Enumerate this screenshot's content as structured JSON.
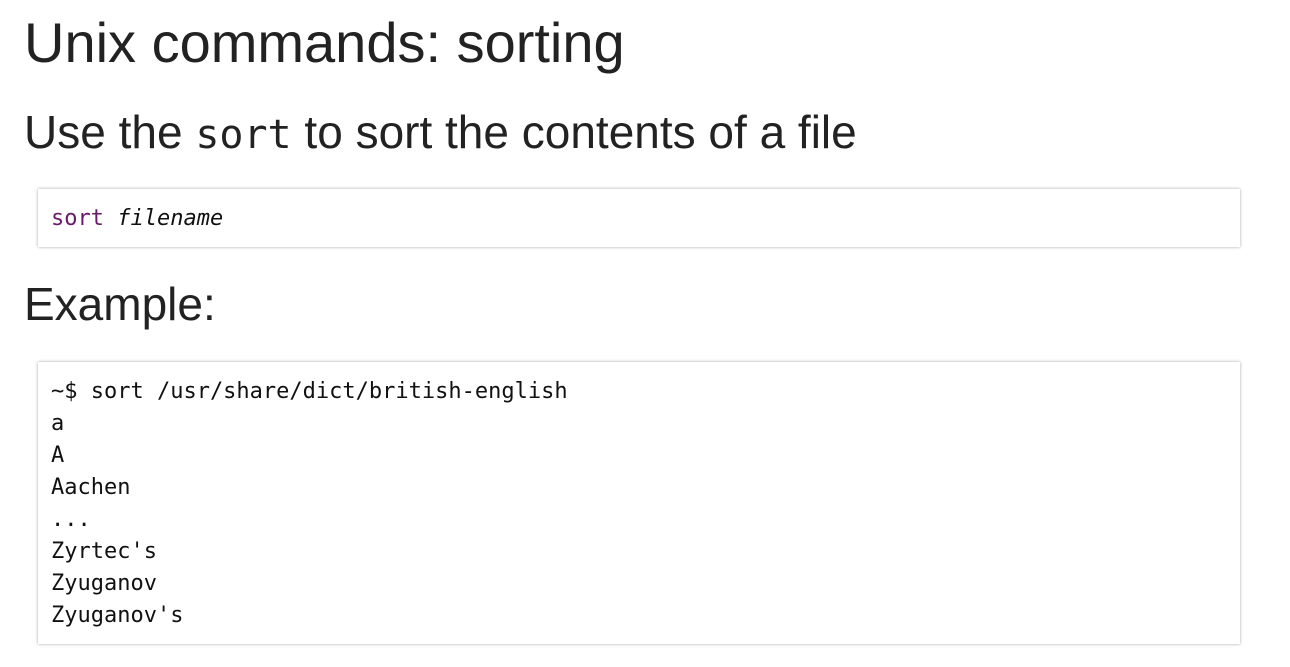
{
  "title": "Unix commands: sorting",
  "subtitle": {
    "before": "Use the ",
    "code": "sort",
    "after": " to sort the contents of a file"
  },
  "syntax": {
    "command": "sort",
    "argument": "filename"
  },
  "example_heading": "Example:",
  "example_lines": [
    "~$ sort /usr/share/dict/british-english",
    "a",
    "A",
    "Aachen",
    "...",
    "Zyrtec's",
    "Zyuganov",
    "Zyuganov's"
  ]
}
